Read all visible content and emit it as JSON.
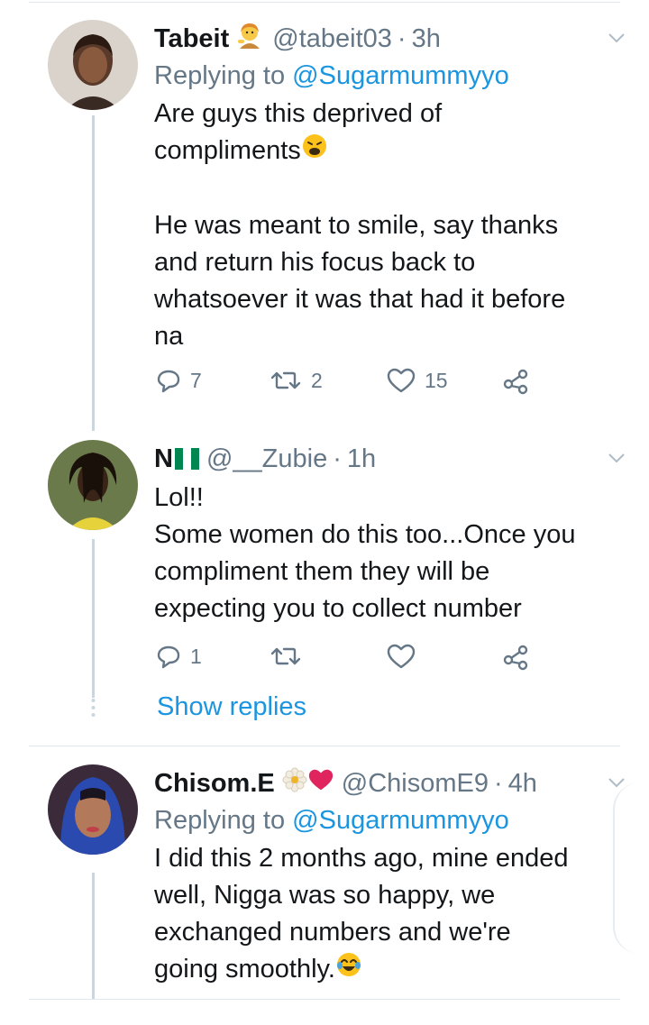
{
  "tweets": [
    {
      "name": "Tabeit",
      "handle": "@tabeit03",
      "dot": "·",
      "time": "3h",
      "replying_prefix": "Replying to ",
      "replying_to": "@Sugarmummyyo",
      "lines": [
        "Are guys this deprived of",
        "compliments"
      ],
      "lines2": [
        "He was meant to smile, say thanks",
        "and return his focus back to",
        "whatsoever it was that had it before",
        "na"
      ],
      "reply_count": "7",
      "retweet_count": "2",
      "like_count": "15"
    },
    {
      "name": "N",
      "handle": "@__Zubie",
      "dot": "·",
      "time": "1h",
      "lines": [
        "Lol!!",
        "Some women do this too...Once you",
        "compliment them they will be",
        "expecting you to collect number"
      ],
      "reply_count": "1",
      "show_replies": "Show replies"
    },
    {
      "name": "Chisom.E",
      "handle": "@ChisomE9",
      "dot": "·",
      "time": "4h",
      "replying_prefix": "Replying to ",
      "replying_to": "@Sugarmummyyo",
      "lines": [
        "I did this 2 months ago, mine ended",
        "well, Nigga was so happy, we",
        "exchanged numbers and we're",
        "going smoothly."
      ]
    }
  ],
  "colors": {
    "link": "#1b95e0",
    "meta": "#657786",
    "text": "#14171a",
    "divider": "#e1e8ed",
    "flag_green": "#008751"
  },
  "icons": [
    "reply-icon",
    "retweet-icon",
    "like-icon",
    "share-icon",
    "chevron-down-icon",
    "weary-face-emoji",
    "joy-emoji",
    "nigeria-flag",
    "blossom-emoji",
    "heart-emoji",
    "woman-tipping-hand-emoji"
  ]
}
